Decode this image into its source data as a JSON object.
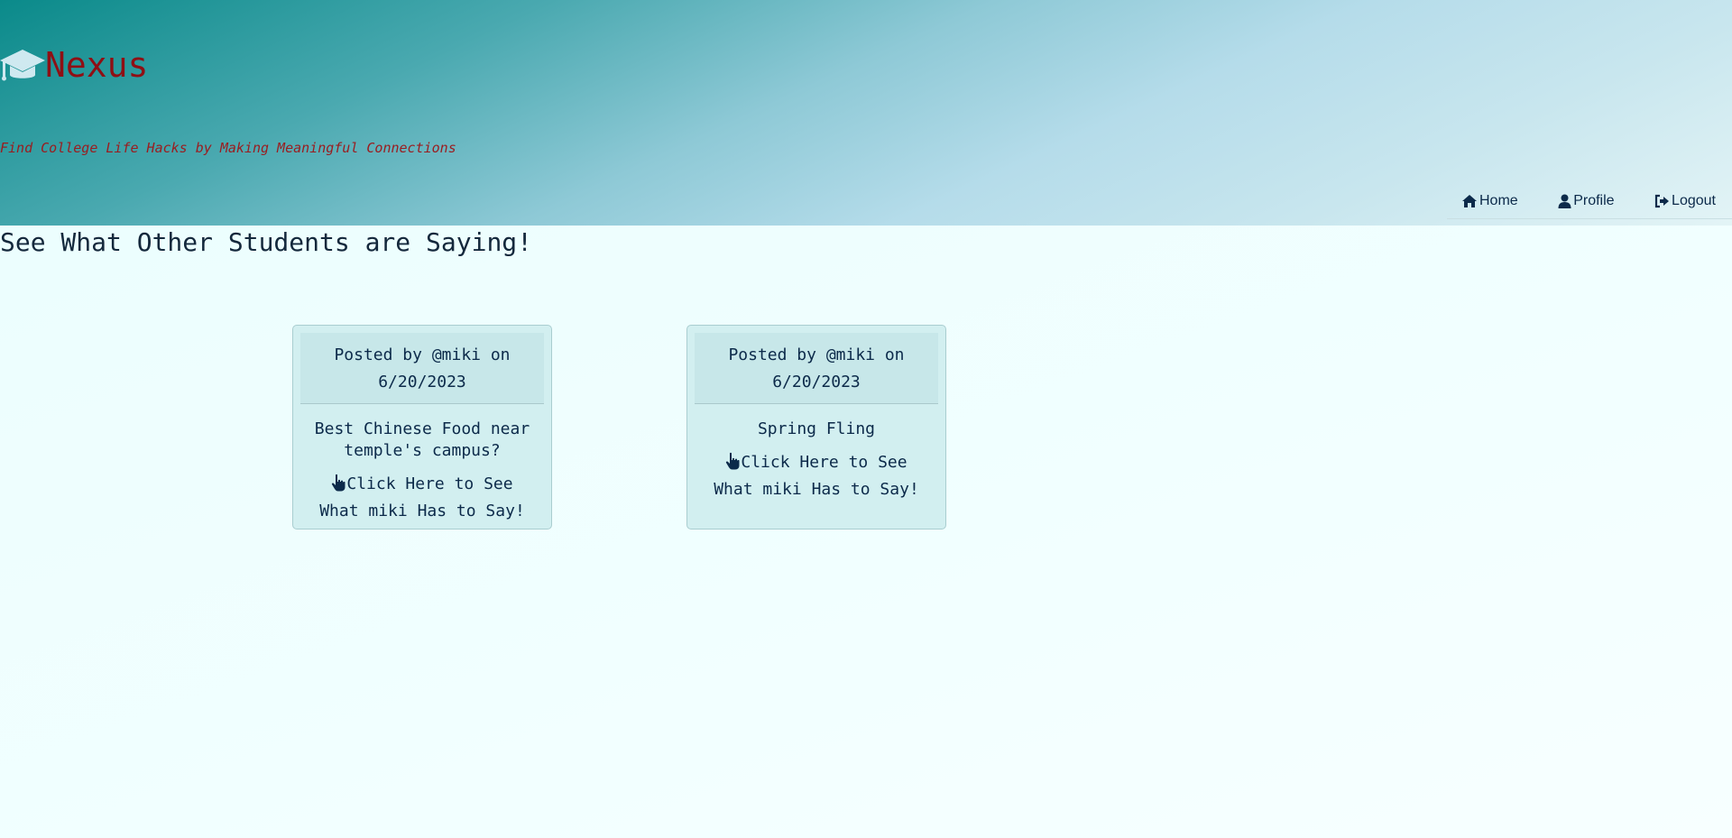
{
  "brand": {
    "icon": "graduation-cap-icon",
    "title": "Nexus",
    "tagline": "Find College Life Hacks by Making Meaningful Connections"
  },
  "nav": {
    "items": [
      {
        "label": "Home",
        "icon": "home-icon"
      },
      {
        "label": "Profile",
        "icon": "user-icon"
      },
      {
        "label": "Logout",
        "icon": "logout-icon"
      }
    ]
  },
  "main": {
    "title": "See What Other Students are Saying!",
    "posts": [
      {
        "posted_by": "Posted by @miki on",
        "date": "6/20/2023",
        "title": "Best Chinese Food near temple's campus?",
        "link_label": "Click Here to See What miki Has to Say!",
        "link_icon": "pointing-hand-icon"
      },
      {
        "posted_by": "Posted by @miki on",
        "date": "6/20/2023",
        "title": "Spring Fling",
        "link_label": "Click Here to See What miki Has to Say!",
        "link_icon": "pointing-hand-icon"
      }
    ]
  },
  "colors": {
    "brand_title": "#8f0f14",
    "text": "#0c2a4a",
    "card_bg": "#d2eff0",
    "page_bg": "#f1ffff"
  }
}
